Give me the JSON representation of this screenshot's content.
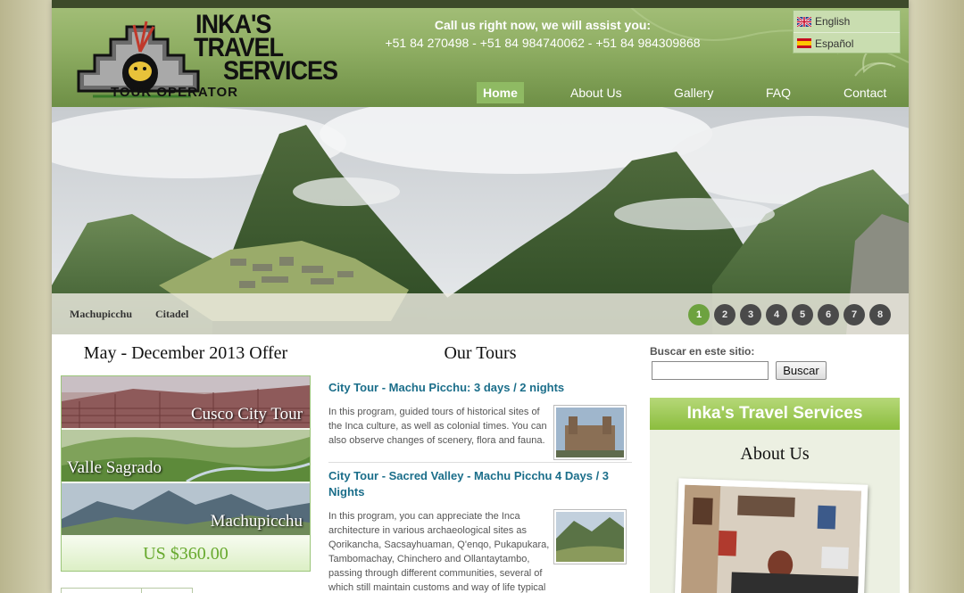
{
  "header": {
    "logo": {
      "line1": "INKA'S",
      "line2": "TRAVEL",
      "line3": "SERVICES",
      "line4": "TOUR OPERATOR"
    },
    "call_text": "Call us right now, we will assist you:",
    "phones": "+51 84 270498 - +51 84 984740062 - +51 84 984309868",
    "languages": [
      {
        "label": "English",
        "icon": "uk-flag-icon"
      },
      {
        "label": "Español",
        "icon": "spain-flag-icon"
      }
    ],
    "nav": [
      {
        "label": "Home",
        "active": true
      },
      {
        "label": "About Us",
        "active": false
      },
      {
        "label": "Gallery",
        "active": false
      },
      {
        "label": "FAQ",
        "active": false
      },
      {
        "label": "Contact",
        "active": false
      }
    ]
  },
  "banner": {
    "caption_title": "Machupicchu",
    "caption_sub": "Citadel",
    "pages": [
      "1",
      "2",
      "3",
      "4",
      "5",
      "6",
      "7",
      "8"
    ],
    "active_page": "1"
  },
  "offer": {
    "title": "May - December 2013 Offer",
    "items": [
      "Cusco City Tour",
      "Valle Sagrado",
      "Machupicchu"
    ],
    "price": "US $360.00"
  },
  "tours": {
    "title": "Our Tours",
    "items": [
      {
        "title": "City Tour - Machu Picchu: 3 days / 2 nights",
        "description": "In this program, guided tours of historical sites of the Inca culture, as well as colonial times. You can also observe changes of scenery, flora and fauna."
      },
      {
        "title": "City Tour - Sacred Valley - Machu Picchu 4 Days / 3 Nights",
        "description": " In this program, you can appreciate the Inca architecture in various archaeological sites as Qorikancha, Sacsayhuaman, Q'enqo, Pukapukara, Tambomachay, Chinchero and Ollantaytambo, passing through different communities, several of which still maintain customs and way of life typical of the area."
      }
    ]
  },
  "sidebar": {
    "search_label": "Buscar en este sitio:",
    "search_value": "",
    "search_button": "Buscar",
    "box_title": "Inka's Travel Services",
    "about_title": "About Us"
  },
  "colors": {
    "header_green": "#8fae63",
    "nav_active": "#8fba63",
    "link_blue": "#1b6e8a",
    "price_green": "#67a92e",
    "dot_active": "#6da23f"
  }
}
